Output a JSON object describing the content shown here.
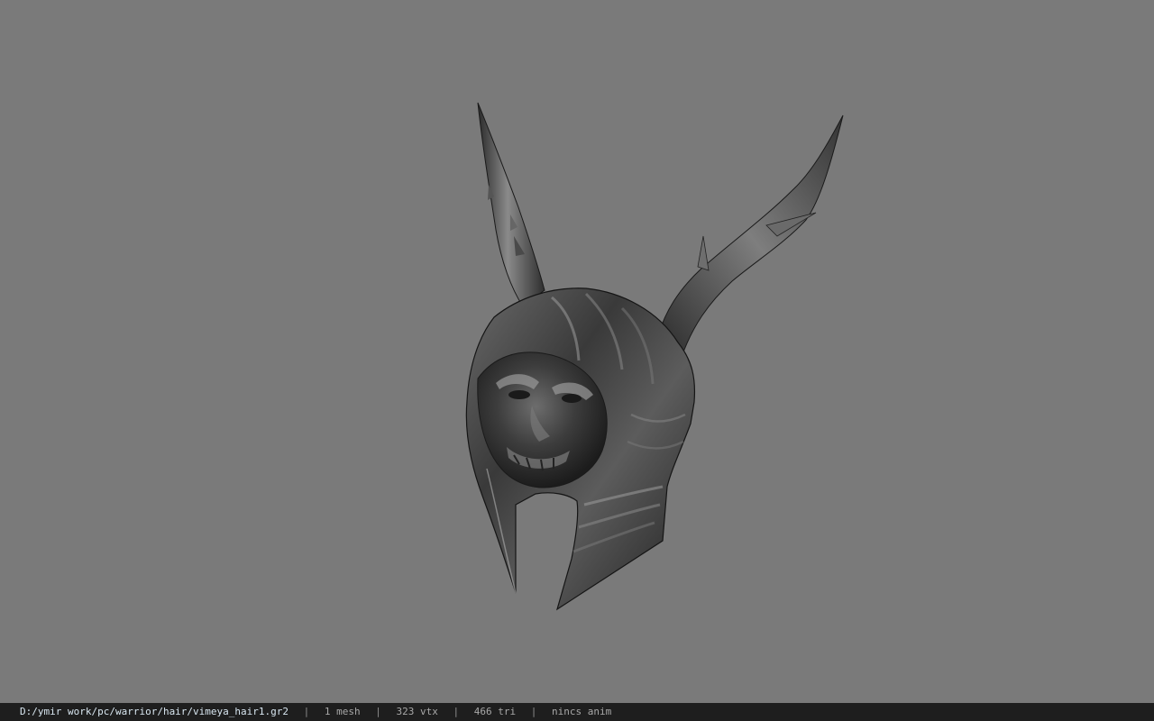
{
  "viewer": {
    "background_color": "#7a7a7a",
    "model_icon": "horned-helmet-model"
  },
  "statusbar": {
    "file_path": "D:/ymir work/pc/warrior/hair/vimeya_hair1.gr2",
    "separator": "|",
    "mesh_count": "1 mesh",
    "vertex_count": "323 vtx",
    "triangle_count": "466 tri",
    "animation": "nincs anim"
  }
}
